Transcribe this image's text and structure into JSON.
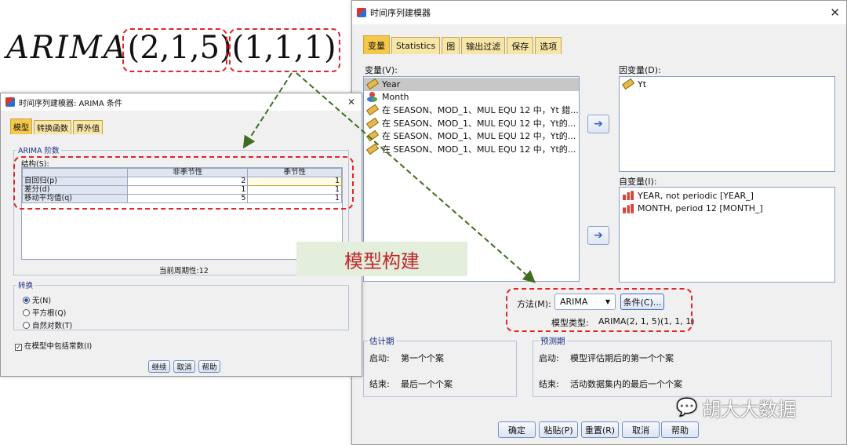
{
  "formula": {
    "prefix": "ARIMA",
    "nonseasonal": "(2,1,5)",
    "seasonal": "(1,1,1)"
  },
  "main_dialog": {
    "title": "时间序列建模器",
    "tabs": [
      "变量",
      "Statistics",
      "图",
      "输出过滤",
      "保存",
      "选项"
    ],
    "variables_label": "变量(V):",
    "variables": [
      {
        "text": "Year",
        "icon": "ruler-icon",
        "selected": true
      },
      {
        "text": "Month",
        "icon": "nominal-icon",
        "selected": false
      },
      {
        "text": "在 SEASON、MOD_1、MUL EQU 12 中，Yt 錯...",
        "icon": "ruler-icon",
        "selected": false
      },
      {
        "text": "在 SEASON、MOD_1、MUL EQU 12 中，Yt的...",
        "icon": "ruler-icon",
        "selected": false
      },
      {
        "text": "在 SEASON、MOD_1、MUL EQU 12 中，Yt的...",
        "icon": "ruler-icon",
        "selected": false
      },
      {
        "text": "在 SEASON、MOD_1、MUL EQU 12 中，Yt的...",
        "icon": "ruler-cross-icon",
        "selected": false
      }
    ],
    "dependent_label": "因变量(D):",
    "dependent": [
      {
        "text": "Yt",
        "icon": "ruler-icon"
      }
    ],
    "independent_label": "自变量(I):",
    "independent": [
      {
        "text": "YEAR, not periodic [YEAR_]",
        "icon": "bar-chart-icon"
      },
      {
        "text": "MONTH, period 12 [MONTH_]",
        "icon": "bar-chart-icon"
      }
    ],
    "method_label": "方法(M):",
    "method_value": "ARIMA",
    "criteria_button": "条件(C)...",
    "model_type_label": "模型类型:",
    "model_type_value": "ARIMA(2, 1, 5)(1, 1, 1)",
    "estimation": {
      "title": "估计期",
      "start_label": "启动:",
      "start_value": "第一个个案",
      "end_label": "结束:",
      "end_value": "最后一个个案"
    },
    "forecast": {
      "title": "预测期",
      "start_label": "启动:",
      "start_value": "模型评估期后的第一个个案",
      "end_label": "结束:",
      "end_value": "活动数据集内的最后一个个案"
    },
    "buttons": [
      "确定",
      "粘贴(P)",
      "重置(R)",
      "取消",
      "帮助"
    ]
  },
  "criteria_dialog": {
    "title": "时间序列建模器: ARIMA 条件",
    "tabs": [
      "模型",
      "转换函数",
      "界外值"
    ],
    "orders_group": "ARIMA 阶数",
    "structure_label": "结构(S):",
    "col_headers": [
      "非季节性",
      "季节性"
    ],
    "rows": [
      {
        "label": "自回归(p)",
        "nonseasonal": "2",
        "seasonal": "1"
      },
      {
        "label": "差分(d)",
        "nonseasonal": "1",
        "seasonal": "1"
      },
      {
        "label": "移动平均值(q)",
        "nonseasonal": "5",
        "seasonal": "1"
      }
    ],
    "periodicity": "当前周期性:12",
    "transform_group": "转换",
    "transform_options": [
      {
        "label": "无(N)",
        "checked": true
      },
      {
        "label": "平方根(Q)",
        "checked": false
      },
      {
        "label": "自然对数(T)",
        "checked": false
      }
    ],
    "include_constant": "在模型中包括常数(I)",
    "buttons": [
      "继续",
      "取消",
      "帮助"
    ]
  },
  "annotation_label": "模型构建",
  "watermark": "胡大大数据",
  "colors": {
    "annotation_red": "#e0262a",
    "annotation_green": "#3f6d1e",
    "tab_active": "#f5c84a"
  }
}
